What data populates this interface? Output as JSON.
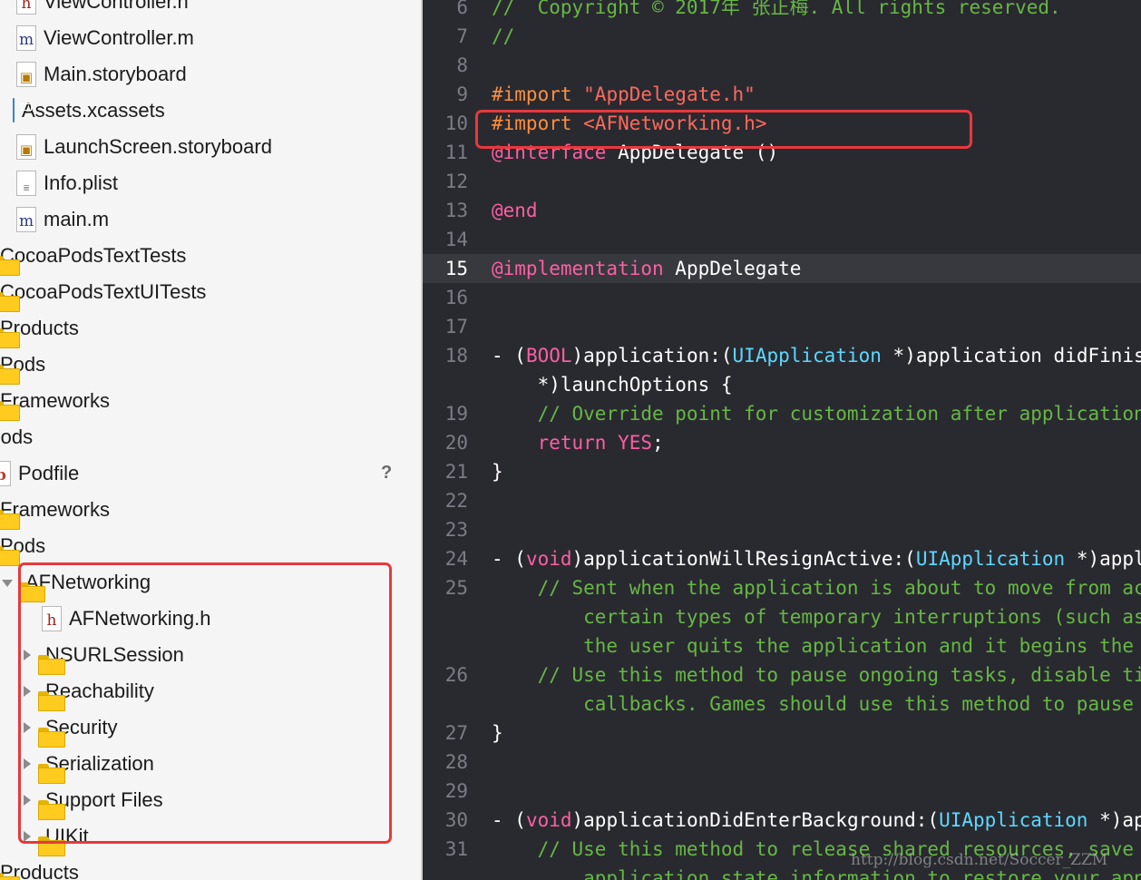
{
  "navigator": {
    "items": [
      {
        "label": "ViewController.h",
        "icon": "header-file-icon"
      },
      {
        "label": "ViewController.m",
        "icon": "implementation-file-icon"
      },
      {
        "label": "Main.storyboard",
        "icon": "storyboard-file-icon"
      },
      {
        "label": "Assets.xcassets",
        "icon": "asset-catalog-icon"
      },
      {
        "label": "LaunchScreen.storyboard",
        "icon": "storyboard-file-icon"
      },
      {
        "label": "Info.plist",
        "icon": "plist-file-icon"
      },
      {
        "label": "main.m",
        "icon": "implementation-file-icon"
      },
      {
        "label": "CocoaPodsTextTests",
        "icon": "folder-icon"
      },
      {
        "label": "CocoaPodsTextUITests",
        "icon": "folder-icon"
      },
      {
        "label": "Products",
        "icon": "folder-icon"
      },
      {
        "label": "Pods",
        "icon": "folder-icon"
      },
      {
        "label": "Frameworks",
        "icon": "folder-icon"
      },
      {
        "label": "Pods",
        "icon": "project-icon"
      },
      {
        "label": "Podfile",
        "icon": "ruby-file-icon",
        "badge": "?"
      },
      {
        "label": "Frameworks",
        "icon": "folder-icon"
      },
      {
        "label": "Pods",
        "icon": "folder-icon"
      },
      {
        "label": "AFNetworking",
        "icon": "folder-icon"
      },
      {
        "label": "AFNetworking.h",
        "icon": "header-file-icon"
      },
      {
        "label": "NSURLSession",
        "icon": "folder-icon"
      },
      {
        "label": "Reachability",
        "icon": "folder-icon"
      },
      {
        "label": "Security",
        "icon": "folder-icon"
      },
      {
        "label": "Serialization",
        "icon": "folder-icon"
      },
      {
        "label": "Support Files",
        "icon": "folder-icon"
      },
      {
        "label": "UIKit",
        "icon": "folder-icon"
      },
      {
        "label": "Products",
        "icon": "folder-icon"
      }
    ]
  },
  "editor": {
    "current_line": "15",
    "lines": [
      {
        "n": "6",
        "tokens": [
          {
            "t": "//  Copyright © 2017年 张正梅. All rights reserved.",
            "c": "cm"
          }
        ]
      },
      {
        "n": "7",
        "tokens": [
          {
            "t": "//",
            "c": "cm"
          }
        ]
      },
      {
        "n": "8",
        "tokens": []
      },
      {
        "n": "9",
        "tokens": [
          {
            "t": "#import ",
            "c": "pre"
          },
          {
            "t": "\"AppDelegate.h\"",
            "c": "str"
          }
        ]
      },
      {
        "n": "10",
        "tokens": [
          {
            "t": "#import ",
            "c": "pre"
          },
          {
            "t": "<AFNetworking.h>",
            "c": "str"
          }
        ]
      },
      {
        "n": "11",
        "tokens": [
          {
            "t": "@interface",
            "c": "kw"
          },
          {
            "t": " AppDelegate ()",
            "c": "plain"
          }
        ]
      },
      {
        "n": "12",
        "tokens": []
      },
      {
        "n": "13",
        "tokens": [
          {
            "t": "@end",
            "c": "kw"
          }
        ]
      },
      {
        "n": "14",
        "tokens": []
      },
      {
        "n": "15",
        "tokens": [
          {
            "t": "@implementation",
            "c": "kw"
          },
          {
            "t": " AppDelegate",
            "c": "plain"
          }
        ]
      },
      {
        "n": "16",
        "tokens": []
      },
      {
        "n": "17",
        "tokens": []
      },
      {
        "n": "18",
        "tokens": [
          {
            "t": "- (",
            "c": "plain"
          },
          {
            "t": "BOOL",
            "c": "kw"
          },
          {
            "t": ")application:(",
            "c": "plain"
          },
          {
            "t": "UIApplication",
            "c": "type"
          },
          {
            "t": " *)application didFinishLaunchingWithOptions:(NSDictionary",
            "c": "plain"
          }
        ]
      },
      {
        "n": "",
        "tokens": [
          {
            "t": "    *)launchOptions {",
            "c": "plain"
          }
        ]
      },
      {
        "n": "19",
        "tokens": [
          {
            "t": "    // Override point for customization after application launch.",
            "c": "cm"
          }
        ]
      },
      {
        "n": "20",
        "tokens": [
          {
            "t": "    ",
            "c": "plain"
          },
          {
            "t": "return",
            "c": "kw"
          },
          {
            "t": " ",
            "c": "plain"
          },
          {
            "t": "YES",
            "c": "kw"
          },
          {
            "t": ";",
            "c": "plain"
          }
        ]
      },
      {
        "n": "21",
        "tokens": [
          {
            "t": "}",
            "c": "plain"
          }
        ]
      },
      {
        "n": "22",
        "tokens": []
      },
      {
        "n": "23",
        "tokens": []
      },
      {
        "n": "24",
        "tokens": [
          {
            "t": "- (",
            "c": "plain"
          },
          {
            "t": "void",
            "c": "kw"
          },
          {
            "t": ")applicationWillResignActive:(",
            "c": "plain"
          },
          {
            "t": "UIApplication",
            "c": "type"
          },
          {
            "t": " *)application {",
            "c": "plain"
          }
        ]
      },
      {
        "n": "25",
        "tokens": [
          {
            "t": "    // Sent when the application is about to move from active to inactive state.",
            "c": "cm"
          }
        ]
      },
      {
        "n": "",
        "tokens": [
          {
            "t": "        certain types of temporary interruptions (such as an incoming phone call",
            "c": "cm"
          }
        ]
      },
      {
        "n": "",
        "tokens": [
          {
            "t": "        the user quits the application and it begins the transition to the background",
            "c": "cm"
          }
        ]
      },
      {
        "n": "26",
        "tokens": [
          {
            "t": "    // Use this method to pause ongoing tasks, disable timers, and invalidate",
            "c": "cm"
          }
        ]
      },
      {
        "n": "",
        "tokens": [
          {
            "t": "        callbacks. Games should use this method to pause the game.",
            "c": "cm"
          }
        ]
      },
      {
        "n": "27",
        "tokens": [
          {
            "t": "}",
            "c": "plain"
          }
        ]
      },
      {
        "n": "28",
        "tokens": []
      },
      {
        "n": "29",
        "tokens": []
      },
      {
        "n": "30",
        "tokens": [
          {
            "t": "- (",
            "c": "plain"
          },
          {
            "t": "void",
            "c": "kw"
          },
          {
            "t": ")applicationDidEnterBackground:(",
            "c": "plain"
          },
          {
            "t": "UIApplication",
            "c": "type"
          },
          {
            "t": " *)application {",
            "c": "plain"
          }
        ]
      },
      {
        "n": "31",
        "tokens": [
          {
            "t": "    // Use this method to release shared resources, save user data, invalidate",
            "c": "cm"
          }
        ]
      },
      {
        "n": "",
        "tokens": [
          {
            "t": "        application state information to restore your application to its current",
            "c": "cm"
          }
        ]
      }
    ]
  },
  "watermark": "http://blog.csdn.net/Soccer_ZZM",
  "colors": {
    "editor_bg": "#292a30",
    "highlight_box": "#e8383d",
    "comment": "#67b744",
    "keyword": "#fc5fa3",
    "string": "#fc6a5d",
    "preprocessor": "#fd8f3f",
    "type": "#5dd8ff"
  }
}
